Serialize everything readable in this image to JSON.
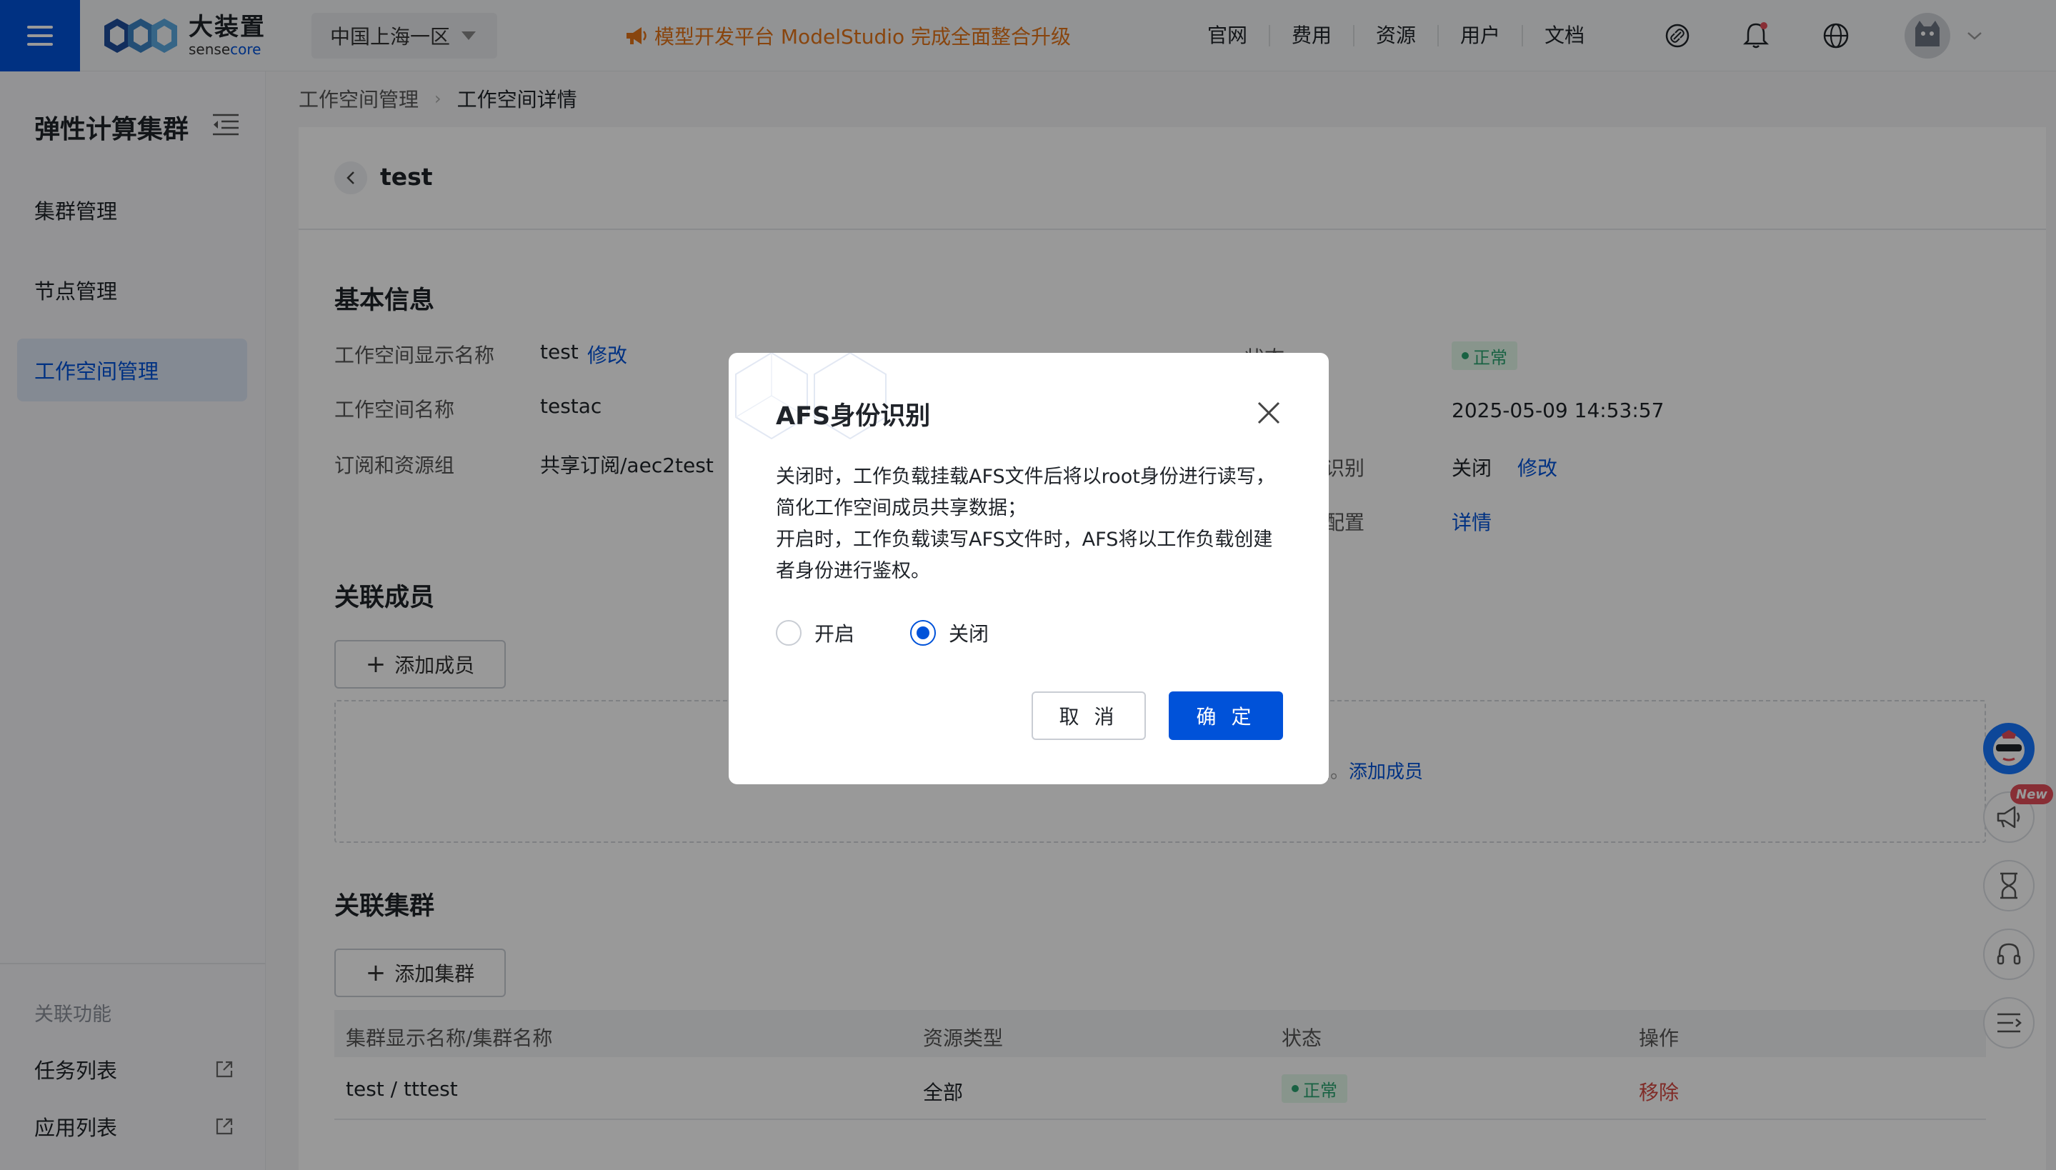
{
  "header": {
    "logo_cn": "大装置",
    "logo_en_a": "sense",
    "logo_en_b": "core",
    "region": "中国上海一区",
    "banner": "模型开发平台 ModelStudio 完成全面整合升级",
    "nav": [
      "官网",
      "费用",
      "资源",
      "用户",
      "文档"
    ]
  },
  "sidebar": {
    "title": "弹性计算集群",
    "items": [
      "集群管理",
      "节点管理",
      "工作空间管理"
    ],
    "active_item": "工作空间管理",
    "related_title": "关联功能",
    "related_links": [
      "任务列表",
      "应用列表"
    ]
  },
  "breadcrumb": [
    "工作空间管理",
    "工作空间详情"
  ],
  "page": {
    "title": "test",
    "basic": {
      "section_title": "基本信息",
      "display_name_label": "工作空间显示名称",
      "display_name_value": "test",
      "modify_label": "修改",
      "name_label": "工作空间名称",
      "name_value": "testac",
      "subscription_label": "订阅和资源组",
      "subscription_value": "共享订阅/aec2test",
      "status_label_partial": "状态",
      "status_value": "正常",
      "created_value": "2025-05-09 14:53:57",
      "afs_label_partial": "识别",
      "afs_value": "关闭",
      "afs_modify": "修改",
      "config_label_partial": "配置",
      "config_link": "详情"
    },
    "members": {
      "section_title": "关联成员",
      "add_button": "添加成员",
      "empty_text": "成员。",
      "empty_link": "添加成员"
    },
    "clusters": {
      "section_title": "关联集群",
      "add_button": "添加集群",
      "columns": [
        "集群显示名称/集群名称",
        "资源类型",
        "状态",
        "操作"
      ],
      "rows": [
        {
          "name": "test / tttest",
          "resource_type": "全部",
          "status": "正常",
          "action": "移除"
        }
      ]
    }
  },
  "dialog": {
    "title": "AFS身份识别",
    "body_line1": "关闭时，工作负载挂载AFS文件后将以root身份进行读写，简化工作空间成员共享数据；",
    "body_line2": "开启时，工作负载读写AFS文件时，AFS将以工作负载创建者身份进行鉴权。",
    "option_on": "开启",
    "option_off": "关闭",
    "selected": "关闭",
    "cancel_label": "取 消",
    "ok_label": "确 定"
  },
  "float_badge": "New",
  "colors": {
    "brand": "#0052d9",
    "banner": "#e37318",
    "success": "#2ba471",
    "danger": "#d54941"
  },
  "icons": [
    "menu-icon",
    "caret-down-icon",
    "megaphone-icon",
    "link-icon",
    "bell-icon",
    "globe-icon",
    "chevron-down-icon",
    "fold-icon",
    "external-link-icon",
    "back-arrow-icon",
    "plus-icon",
    "close-icon",
    "mascot-icon",
    "announcement-icon",
    "hourglass-icon",
    "headset-icon",
    "collapse-icon"
  ]
}
